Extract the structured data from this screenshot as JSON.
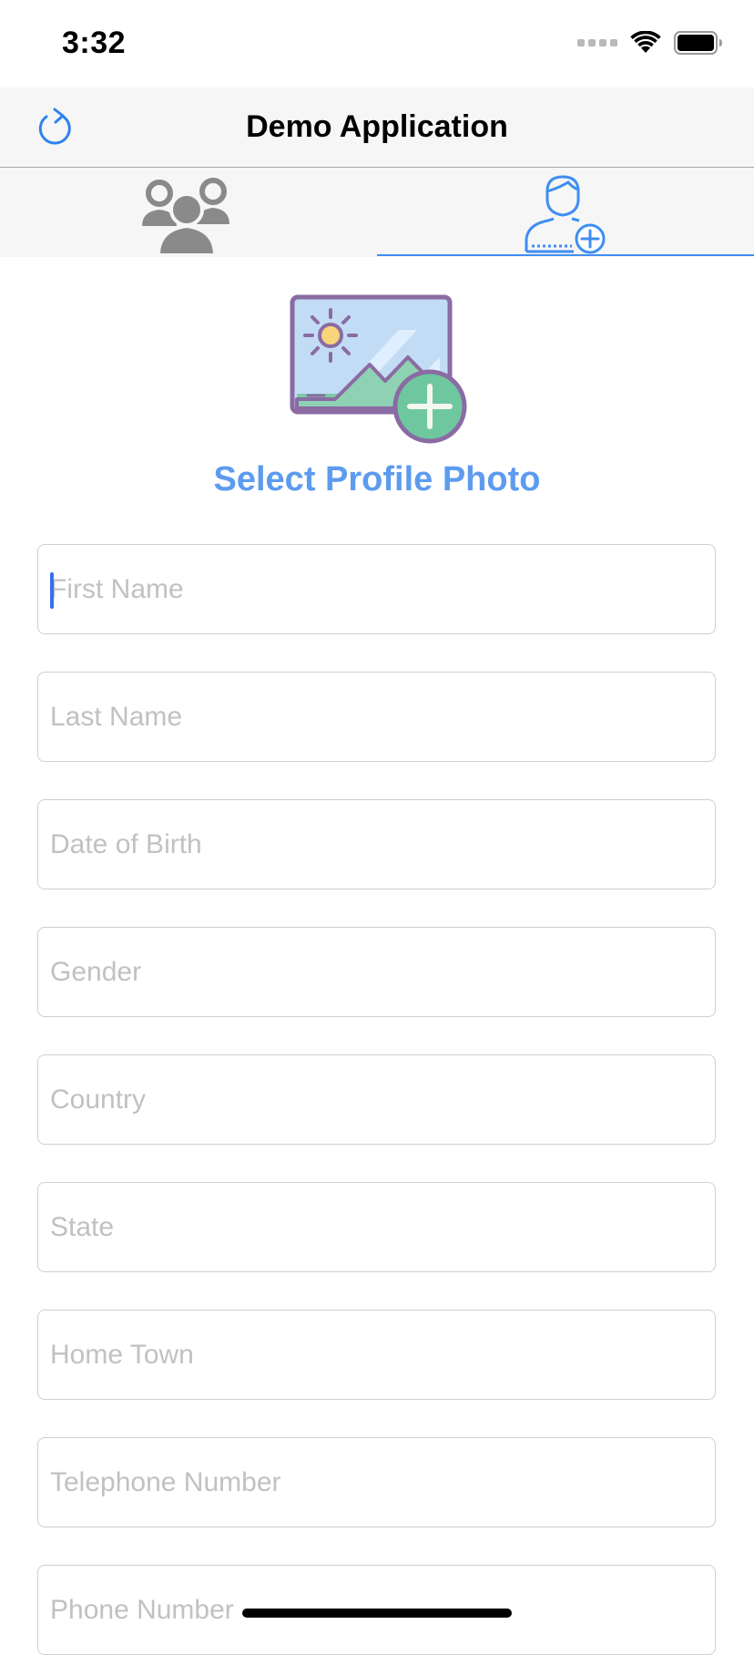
{
  "status_bar": {
    "time": "3:32",
    "icons": [
      "cellular-signal-icon",
      "wifi-icon",
      "battery-icon"
    ]
  },
  "nav": {
    "title": "Demo Application",
    "refresh_icon": "refresh-icon"
  },
  "tabs": [
    {
      "name": "contacts",
      "icon": "contacts-icon",
      "selected": false
    },
    {
      "name": "add-contact",
      "icon": "add-user-icon",
      "selected": true
    }
  ],
  "photo": {
    "icon": "add-photo-icon",
    "label": "Select Profile Photo"
  },
  "form": {
    "first_name": {
      "placeholder": "First Name",
      "value": ""
    },
    "last_name": {
      "placeholder": "Last Name",
      "value": ""
    },
    "date_of_birth": {
      "placeholder": "Date of Birth",
      "value": ""
    },
    "gender": {
      "placeholder": "Gender",
      "value": ""
    },
    "country": {
      "placeholder": "Country",
      "value": ""
    },
    "state": {
      "placeholder": "State",
      "value": ""
    },
    "home_town": {
      "placeholder": "Home Town",
      "value": ""
    },
    "telephone_number": {
      "placeholder": "Telephone Number",
      "value": ""
    },
    "phone_number": {
      "placeholder": "Phone Number",
      "value": ""
    }
  },
  "colors": {
    "accent": "#3f8ef2",
    "photo_label": "#5d9bef",
    "caret": "#3a6ee8",
    "placeholder": "#c1c1c5",
    "bar_background": "#f6f6f6"
  }
}
